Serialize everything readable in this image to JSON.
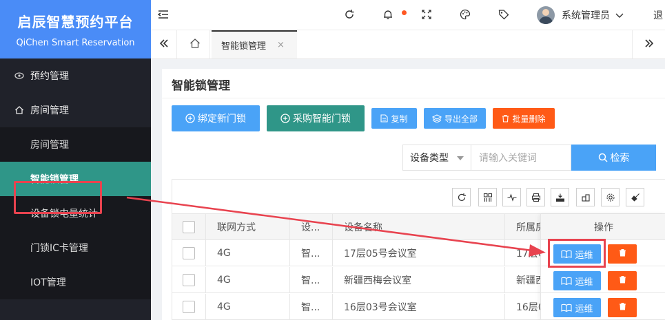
{
  "brand": {
    "title": "启辰智慧预约平台",
    "subtitle": "QiChen Smart Reservation"
  },
  "sidebar": {
    "items": [
      {
        "label": "预约管理",
        "icon": "eye-icon"
      },
      {
        "label": "房间管理",
        "icon": "home-icon"
      }
    ],
    "subitems": [
      {
        "label": "房间管理"
      },
      {
        "label": "智能锁管理"
      },
      {
        "label": "设备锁电量统计"
      },
      {
        "label": "门锁IC卡管理"
      },
      {
        "label": "IOT管理"
      }
    ]
  },
  "topbar": {
    "username": "系统管理员",
    "logout": "退"
  },
  "tabs": {
    "current": "智能锁管理",
    "close": "×"
  },
  "page": {
    "title": "智能锁管理",
    "buttons": {
      "bind": "绑定新门锁",
      "buy": "采购智能门锁",
      "copy": "复制",
      "export": "导出全部",
      "batch_delete": "批量删除"
    },
    "search": {
      "select_value": "设备类型",
      "placeholder": "请输入关键词",
      "button": "检索"
    }
  },
  "table": {
    "headers": [
      "联网方式",
      "设...",
      "设备名称",
      "所属房",
      "操作"
    ],
    "rows": [
      {
        "network": "4G",
        "type": "智...",
        "name": "17层05号会议室",
        "room": "17层0"
      },
      {
        "network": "4G",
        "type": "智...",
        "name": "新疆西梅会议室",
        "room": "新疆西"
      },
      {
        "network": "4G",
        "type": "智...",
        "name": "16层03号会议室",
        "room": "16层0"
      }
    ],
    "op_label": "运维"
  },
  "colors": {
    "brand": "#4a8cf7",
    "active_menu": "#2f9688",
    "primary": "#4aa3f7",
    "danger": "#ff5a16",
    "highlight": "#e8434f"
  }
}
